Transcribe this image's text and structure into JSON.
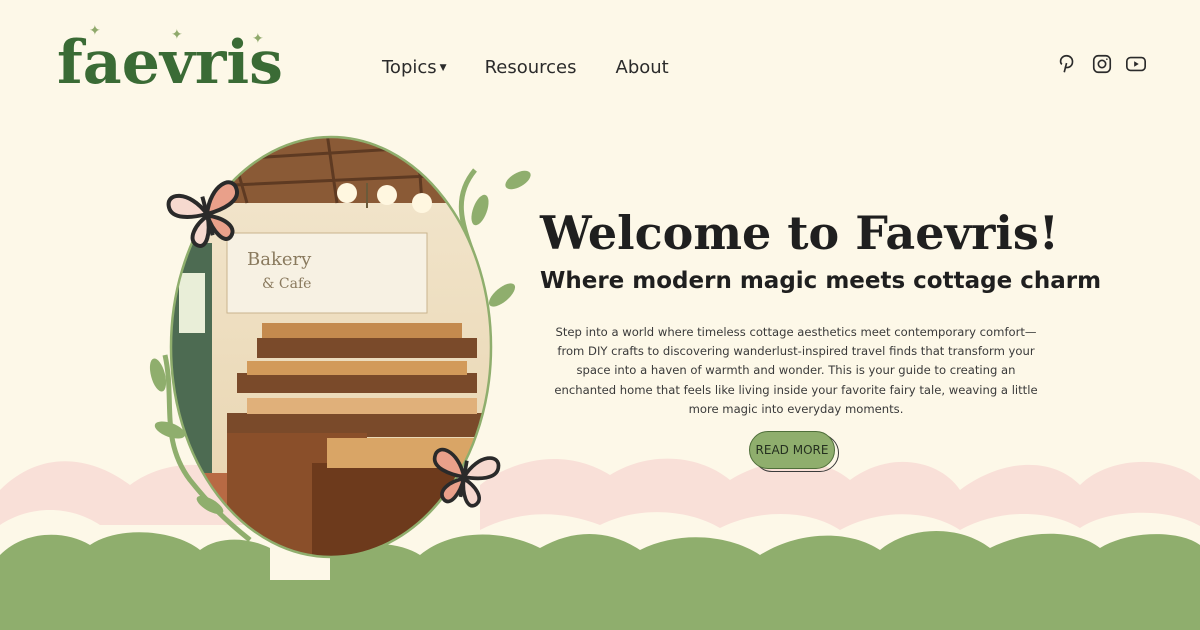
{
  "brand": {
    "name": "faevris"
  },
  "nav": {
    "items": [
      {
        "label": "Topics",
        "has_dropdown": true
      },
      {
        "label": "Resources",
        "has_dropdown": false
      },
      {
        "label": "About",
        "has_dropdown": false
      }
    ]
  },
  "social": [
    {
      "icon": "pinterest-icon"
    },
    {
      "icon": "instagram-icon"
    },
    {
      "icon": "youtube-icon"
    }
  ],
  "hero": {
    "title": "Welcome to Faevris!",
    "subtitle": "Where modern magic meets cottage charm",
    "body": "Step into a world where timeless cottage aesthetics meet contemporary comfort—from DIY crafts to discovering wanderlust-inspired travel finds that transform your space into a haven of warmth and wonder. This is your guide to creating an enchanted home that feels like living inside your favorite fairy tale, weaving a little more magic into everyday moments.",
    "cta_label": "READ MORE"
  },
  "illustration": {
    "sign_line1": "Bakery",
    "sign_line2": "& Cafe"
  },
  "colors": {
    "background": "#fdf8e8",
    "brand_green": "#3a6b35",
    "hill_green": "#8fae6d",
    "hill_pink": "#f9e0d8",
    "butterfly_accent": "#e9a08a"
  }
}
